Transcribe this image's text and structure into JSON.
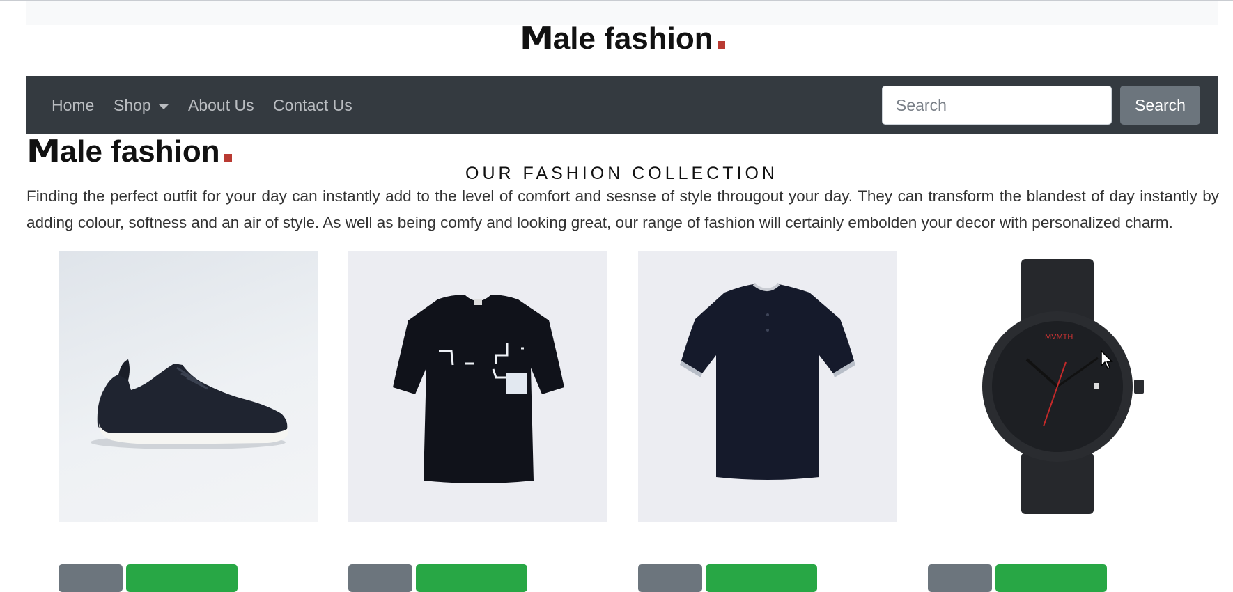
{
  "brand": {
    "logo_first_letter": "M",
    "logo_text": "ale fashion",
    "accent_color": "#b93a32"
  },
  "navbar": {
    "links": [
      {
        "label": "Home"
      },
      {
        "label": "Shop",
        "has_dropdown": true,
        "icon": "caret-down-icon"
      },
      {
        "label": "About Us"
      },
      {
        "label": "Contact Us"
      }
    ],
    "search": {
      "placeholder": "Search",
      "value": "",
      "button_label": "Search"
    },
    "background_color": "#343a40"
  },
  "collection": {
    "title": "OUR FASHION COLLECTION",
    "description": "Finding the perfect outfit for your day can instantly add to the level of comfort and sesnse of style througout your day. They can transform the blandest of day instantly by adding colour, softness and an air of style. As well as being comfy and looking great, our range of fashion will certainly embolden your decor with personalized charm."
  },
  "products": [
    {
      "image": "black-sneaker-image"
    },
    {
      "image": "black-graphic-tshirt-image"
    },
    {
      "image": "navy-polo-shirt-image"
    },
    {
      "image": "black-wristwatch-image",
      "watch_brand_text": "MVMTH"
    }
  ],
  "button_colors": {
    "secondary": "#6c757d",
    "success": "#28a745"
  }
}
